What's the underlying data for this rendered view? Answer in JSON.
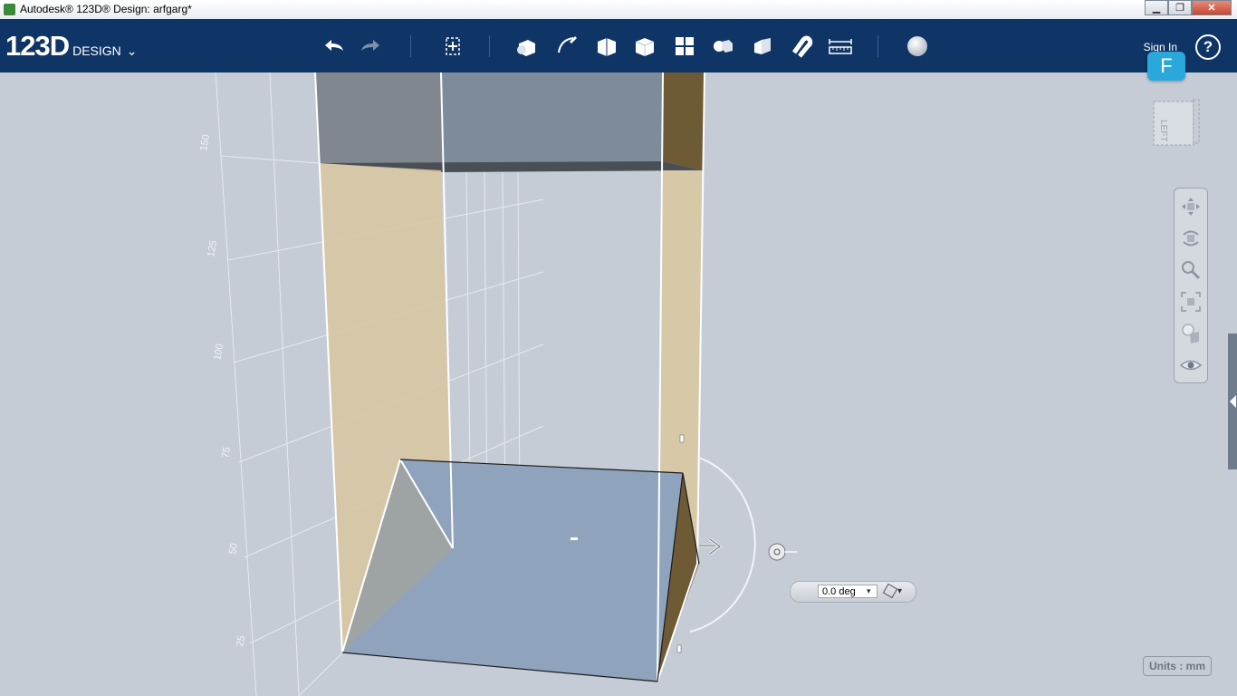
{
  "window": {
    "title": "Autodesk® 123D® Design: arfgarg*",
    "buttons": [
      "▁",
      "❐",
      "✕"
    ]
  },
  "toolbar": {
    "logo_main": "123D",
    "logo_sub": "DESIGN",
    "logo_chevron": "⌄",
    "sign_in": "Sign In",
    "help": "?",
    "account_badge": "F",
    "tools": [
      "undo-icon",
      "redo-icon",
      "transform-icon",
      "primitives-icon",
      "sketch-icon",
      "construct-icon",
      "modify-icon",
      "pattern-icon",
      "grouping-icon",
      "combine-icon",
      "snap-icon",
      "measure-icon",
      "material-icon"
    ]
  },
  "viewcube": {
    "face_label": "LEFT"
  },
  "navbar": {
    "items": [
      "pan-icon",
      "orbit-icon",
      "zoom-icon",
      "fit-icon",
      "visibility-icon",
      "eye-icon"
    ]
  },
  "grid": {
    "ruler_labels": [
      "150",
      "125",
      "100",
      "75",
      "50",
      "25"
    ]
  },
  "rotate_widget": {
    "angle_value": "0.0 deg",
    "dropdown": "▾",
    "snap_dropdown": "▾"
  },
  "status": {
    "units": "Units : mm"
  },
  "colors": {
    "toolbar_bg": "#0f3566",
    "viewport_bg": "#c5ccd6",
    "accent": "#2aa8dc",
    "panel_tan": "#d8c7a4",
    "panel_dark": "#6e5a35",
    "box_blue": "#8fa4bc"
  }
}
